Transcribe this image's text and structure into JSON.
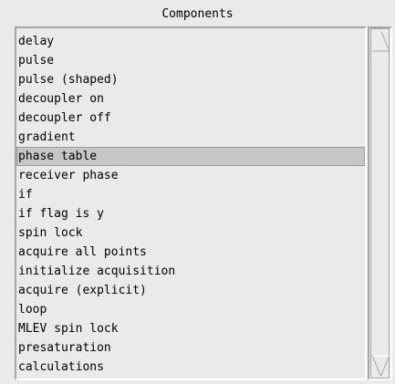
{
  "panel": {
    "title": "Components"
  },
  "list": {
    "items": [
      {
        "label": "delay"
      },
      {
        "label": "pulse"
      },
      {
        "label": "pulse (shaped)"
      },
      {
        "label": "decoupler on"
      },
      {
        "label": "decoupler off"
      },
      {
        "label": "gradient"
      },
      {
        "label": "phase table"
      },
      {
        "label": "receiver phase"
      },
      {
        "label": "if"
      },
      {
        "label": "if flag is y"
      },
      {
        "label": "spin lock"
      },
      {
        "label": "acquire all points"
      },
      {
        "label": "initialize acquisition"
      },
      {
        "label": "acquire (explicit)"
      },
      {
        "label": "loop"
      },
      {
        "label": "MLEV spin lock"
      },
      {
        "label": "presaturation"
      },
      {
        "label": "calculations"
      }
    ],
    "selected_label": "phase table"
  },
  "scrollbar": {
    "up_icon": "triangle-up-icon",
    "down_icon": "triangle-down-icon"
  }
}
